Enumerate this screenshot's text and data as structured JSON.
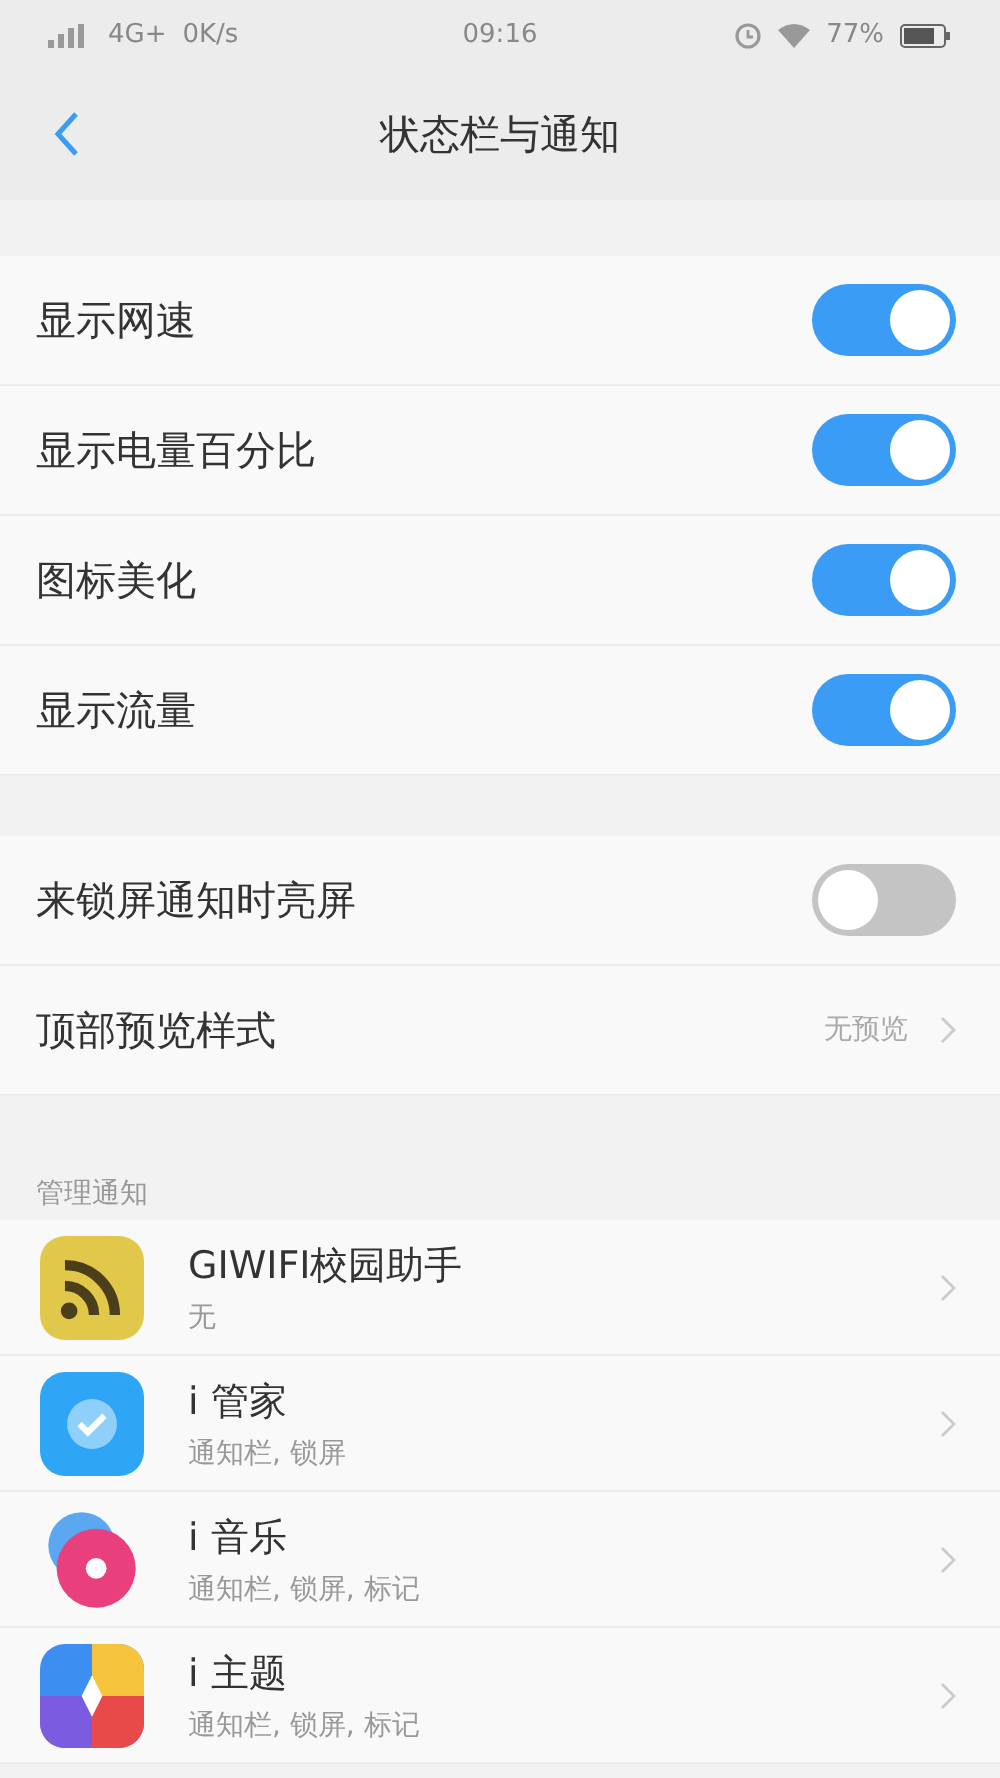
{
  "status_bar": {
    "network": "4G+",
    "speed": "0K/s",
    "time": "09:16",
    "battery": "77%"
  },
  "nav": {
    "title": "状态栏与通知"
  },
  "groups": [
    {
      "rows": [
        {
          "label": "显示网速",
          "kind": "toggle",
          "on": true
        },
        {
          "label": "显示电量百分比",
          "kind": "toggle",
          "on": true
        },
        {
          "label": "图标美化",
          "kind": "toggle",
          "on": true
        },
        {
          "label": "显示流量",
          "kind": "toggle",
          "on": true
        }
      ]
    },
    {
      "rows": [
        {
          "label": "来锁屏通知时亮屏",
          "kind": "toggle",
          "on": false
        },
        {
          "label": "顶部预览样式",
          "kind": "link",
          "value": "无预览"
        }
      ]
    }
  ],
  "section": {
    "title": "管理通知"
  },
  "apps": [
    {
      "name": "GIWIFI校园助手",
      "detail": "无",
      "kind": "wifi"
    },
    {
      "name": "i 管家",
      "detail": "通知栏, 锁屏",
      "kind": "shield"
    },
    {
      "name": "i 音乐",
      "detail": "通知栏, 锁屏, 标记",
      "kind": "music"
    },
    {
      "name": "i 主题",
      "detail": "通知栏, 锁屏, 标记",
      "kind": "theme"
    }
  ]
}
